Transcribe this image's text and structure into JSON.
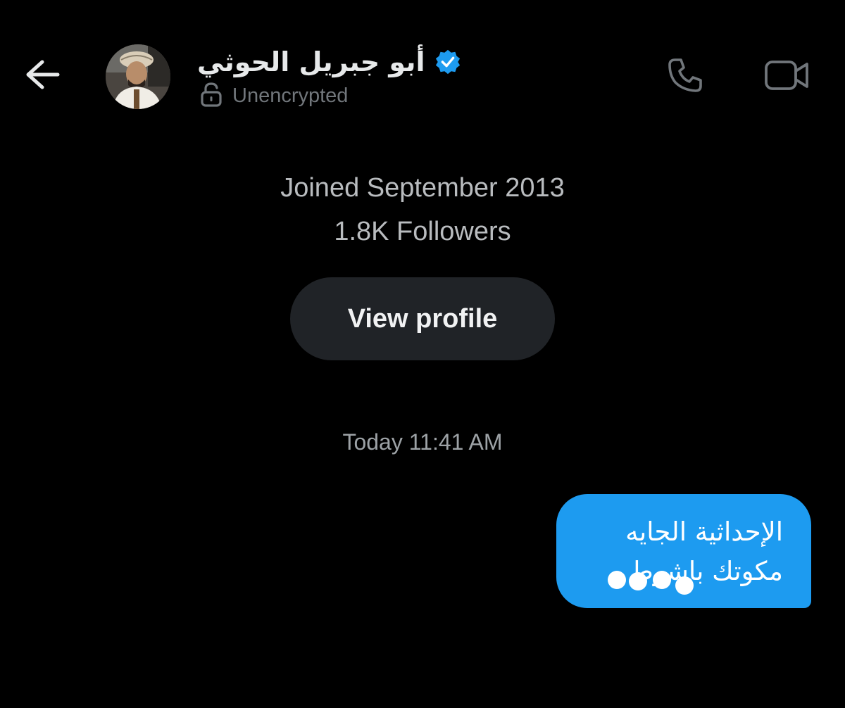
{
  "header": {
    "back_icon": "arrow-left-icon",
    "name": "أبو جبريل الحوثي",
    "verified_icon": "verified-badge-icon",
    "verified_color": "#1d9bf0",
    "status_icon": "unlocked-icon",
    "status": "Unencrypted",
    "call_icon": "phone-icon",
    "video_icon": "video-camera-icon"
  },
  "profile_summary": {
    "joined": "Joined September 2013",
    "followers": "1.8K Followers",
    "view_profile_label": "View profile"
  },
  "conversation": {
    "timestamp": "Today 11:41 AM",
    "messages": [
      {
        "direction": "outgoing",
        "lines": [
          "الإحداثية الجايه",
          "مكوتك باشوط"
        ],
        "bubble_color": "#1d9bf0"
      }
    ]
  },
  "colors": {
    "background": "#000000",
    "primary_text": "#e7e9ea",
    "secondary_text": "#71767b",
    "button_bg": "#202327",
    "accent": "#1d9bf0"
  }
}
